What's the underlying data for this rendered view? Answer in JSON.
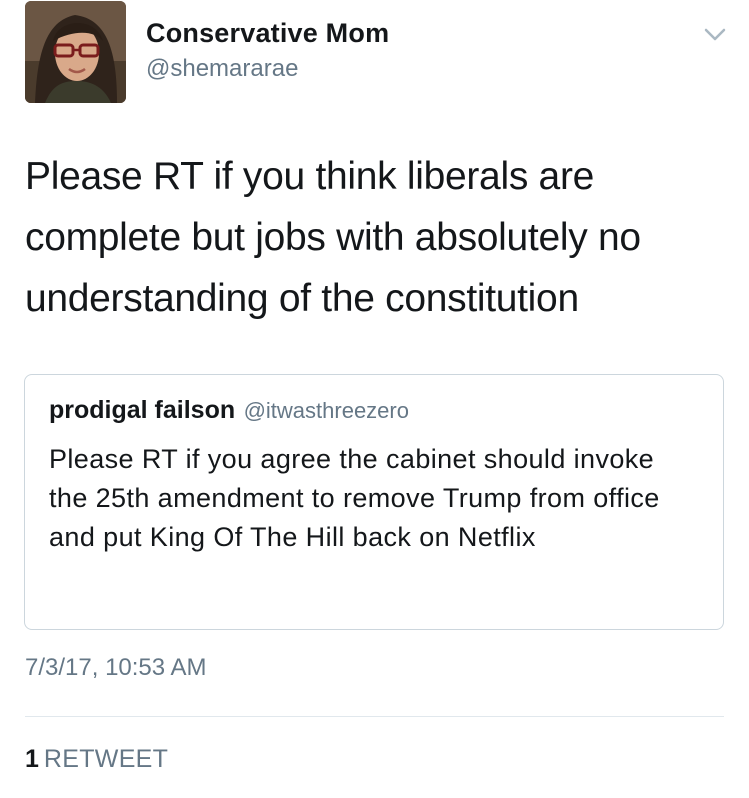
{
  "tweet": {
    "author": {
      "name": "Conservative  Mom",
      "handle": "@shemararae",
      "avatar": "profile-photo"
    },
    "menu_icon": "chevron-down-icon",
    "text": "Please RT if you think liberals are complete but jobs with absolutely no understanding of the constitution",
    "quoted": {
      "name": "prodigal failson",
      "handle": "@itwasthreezero",
      "text": "Please RT if you agree the cabinet should invoke the 25th amendment to remove Trump from office and put King Of The Hill back on Netflix"
    },
    "timestamp": "7/3/17, 10:53 AM",
    "retweets": {
      "count": "1",
      "label": "RETWEET"
    }
  },
  "colors": {
    "primary_text": "#14171a",
    "secondary_text": "#657786",
    "border": "#ccd6dd",
    "divider": "#e1e8ed",
    "background": "#ffffff"
  }
}
